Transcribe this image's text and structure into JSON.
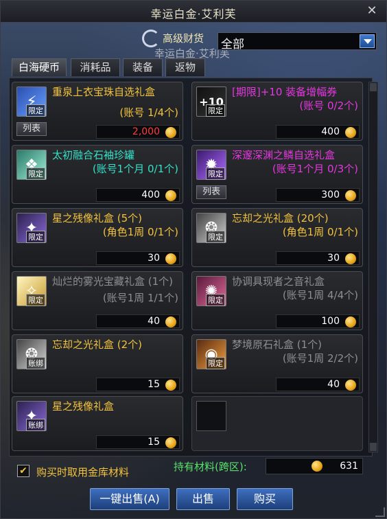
{
  "window": {
    "title": "幸运白金·艾利芙",
    "close_glyph": "✕"
  },
  "header": {
    "subtitle": "高级财货",
    "shop_name": "幸运白金·艾利芙"
  },
  "filter": {
    "selected": "全部"
  },
  "tabs": [
    {
      "label": "白海硬币",
      "active": true
    },
    {
      "label": "消耗品",
      "active": false
    },
    {
      "label": "装备",
      "active": false
    },
    {
      "label": "返物",
      "active": false
    }
  ],
  "items": [
    {
      "name": "重泉上衣宝珠自选礼盒",
      "sub": "(账号 1/4个)",
      "badge": "限定",
      "price": "2,000",
      "price_red": true,
      "list_button": "列表",
      "name_color": "gold"
    },
    {
      "name": "[期限]+10 装备增幅券",
      "sub": "(账号 0/2个)",
      "badge": "限定",
      "price": "400",
      "name_color": "pink"
    },
    {
      "name": "太初融合石袖珍罐",
      "sub": "(账号1个月 0/1个)",
      "badge": "限定",
      "price": "400",
      "name_color": "cyan"
    },
    {
      "name": "深邃深渊之鳞自选礼盒",
      "sub": "(账号1个月 0/3个)",
      "badge": "限定",
      "price": "300",
      "list_button": "列表",
      "name_color": "pink"
    },
    {
      "name": "星之残像礼盒 (5个)",
      "sub": "(角色1周 0/1个)",
      "badge": "限定",
      "price": "30",
      "name_color": "gold"
    },
    {
      "name": "忘却之光礼盒 (20个)",
      "sub": "(角色1周 0/1个)",
      "badge": "限定",
      "price": "30",
      "name_color": "gold"
    },
    {
      "name": "灿烂的雾光宝藏礼盒 (1个)",
      "sub": "(账号1周 1/1个)",
      "badge": "限定",
      "price": "40",
      "name_color": "gray"
    },
    {
      "name": "协调具现者之音礼盒",
      "sub": "(账号1周 4/4个)",
      "badge": "限定",
      "price": "100",
      "name_color": "gray"
    },
    {
      "name": "忘却之光礼盒 (2个)",
      "sub": "",
      "badge": "账绑",
      "price": "15",
      "name_color": "gold"
    },
    {
      "name": "梦境原石礼盒 (1个)",
      "sub": "(账号1周 2/2个)",
      "badge": "限定",
      "price": "40",
      "name_color": "gray"
    },
    {
      "name": "星之残像礼盒",
      "sub": "",
      "badge": "账绑",
      "price": "15",
      "name_color": "gold"
    }
  ],
  "footer": {
    "checkbox_label": "购买时取用金库材料",
    "checkbox_checked": true,
    "material_label": "持有材料(跨区):",
    "material_value": "631",
    "buttons": {
      "sell_all": "一键出售(A)",
      "sell": "出售",
      "buy": "购买"
    }
  }
}
